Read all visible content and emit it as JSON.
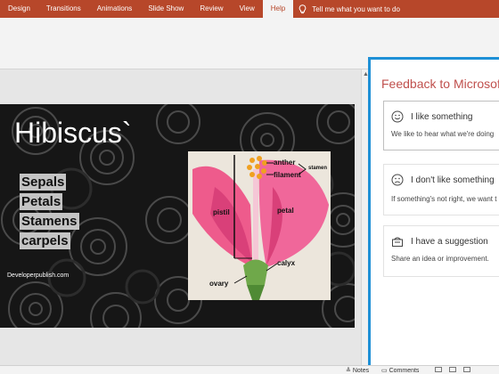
{
  "ribbon": {
    "tabs": [
      {
        "label": "Design"
      },
      {
        "label": "Transitions"
      },
      {
        "label": "Animations"
      },
      {
        "label": "Slide Show"
      },
      {
        "label": "Review"
      },
      {
        "label": "View"
      },
      {
        "label": "Help"
      }
    ],
    "active_tab": "Help",
    "tell_me": "Tell me what you want to do"
  },
  "slide": {
    "title": "Hibiscus`",
    "bullets": [
      "Sepals",
      "Petals",
      "Stamens",
      "carpels"
    ],
    "credit": "Developerpublish.com",
    "diagram_labels": {
      "anther": "anther",
      "filament": "filament",
      "stamen": "stamen",
      "pistil": "pistil",
      "petal": "petal",
      "calyx": "calyx",
      "ovary": "ovary"
    }
  },
  "feedback": {
    "title": "Feedback to Microsoft",
    "options": [
      {
        "label": "I like something",
        "sub": "We like to hear what we're doing"
      },
      {
        "label": "I don't like something",
        "sub": "If something's not right, we want t"
      },
      {
        "label": "I have a suggestion",
        "sub": "Share an idea or improvement."
      }
    ]
  },
  "statusbar": {
    "notes": "Notes",
    "comments": "Comments"
  },
  "colors": {
    "ribbon_accent": "#b7472a",
    "pane_border": "#1e90d6",
    "pane_title": "#c0504d"
  }
}
